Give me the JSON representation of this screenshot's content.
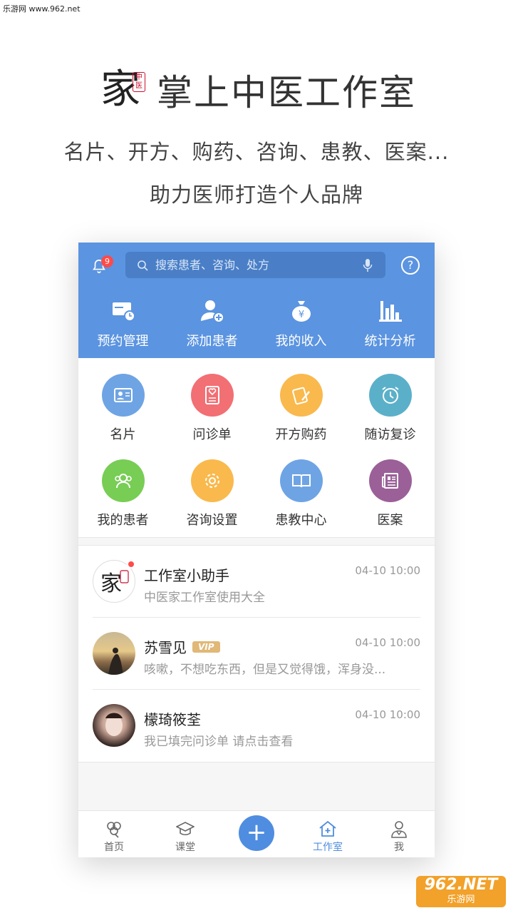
{
  "watermark": {
    "text": "乐游网 www.962.net"
  },
  "promo": {
    "logo_char": "家",
    "logo_seal": "中医",
    "title": "掌上中医工作室",
    "line1": "名片、开方、购药、咨询、患教、医案...",
    "line2": "助力医师打造个人品牌"
  },
  "header": {
    "notification_count": "9",
    "search_placeholder": "搜索患者、咨询、处方",
    "help_label": "?",
    "quick_actions": [
      {
        "label": "预约管理",
        "icon": "calendar-clock-icon"
      },
      {
        "label": "添加患者",
        "icon": "add-user-icon"
      },
      {
        "label": "我的收入",
        "icon": "money-bag-icon"
      },
      {
        "label": "统计分析",
        "icon": "bar-chart-icon"
      }
    ]
  },
  "grid": [
    {
      "label": "名片",
      "icon": "card-icon",
      "color": "#6ea4e4"
    },
    {
      "label": "问诊单",
      "icon": "heart-form-icon",
      "color": "#f26f74"
    },
    {
      "label": "开方购药",
      "icon": "prescription-icon",
      "color": "#f9b94d"
    },
    {
      "label": "随访复诊",
      "icon": "alarm-clock-icon",
      "color": "#5bb0c9"
    },
    {
      "label": "我的患者",
      "icon": "patients-icon",
      "color": "#78cd55"
    },
    {
      "label": "咨询设置",
      "icon": "gear-icon",
      "color": "#f9b94d"
    },
    {
      "label": "患教中心",
      "icon": "book-icon",
      "color": "#6ea4e4"
    },
    {
      "label": "医案",
      "icon": "newspaper-icon",
      "color": "#9b6098"
    }
  ],
  "messages": [
    {
      "name": "工作室小助手",
      "time": "04-10 10:00",
      "preview": "中医家工作室使用大全",
      "vip": ""
    },
    {
      "name": "苏雪见",
      "time": "04-10 10:00",
      "preview": "咳嗽，不想吃东西，但是又觉得饿，浑身没...",
      "vip": "VIP"
    },
    {
      "name": "檬琦筱荃",
      "time": "04-10 10:00",
      "preview": "我已填完问诊单 请点击查看",
      "vip": ""
    }
  ],
  "tabbar": {
    "home": "首页",
    "course": "课堂",
    "studio": "工作室",
    "me": "我",
    "add": "+"
  },
  "brand": {
    "big": "962.NET",
    "small": "乐游网"
  },
  "colors": {
    "primary": "#5b94e0",
    "accent_blue": "#4f8de0",
    "badge_red": "#ff4a4a"
  }
}
